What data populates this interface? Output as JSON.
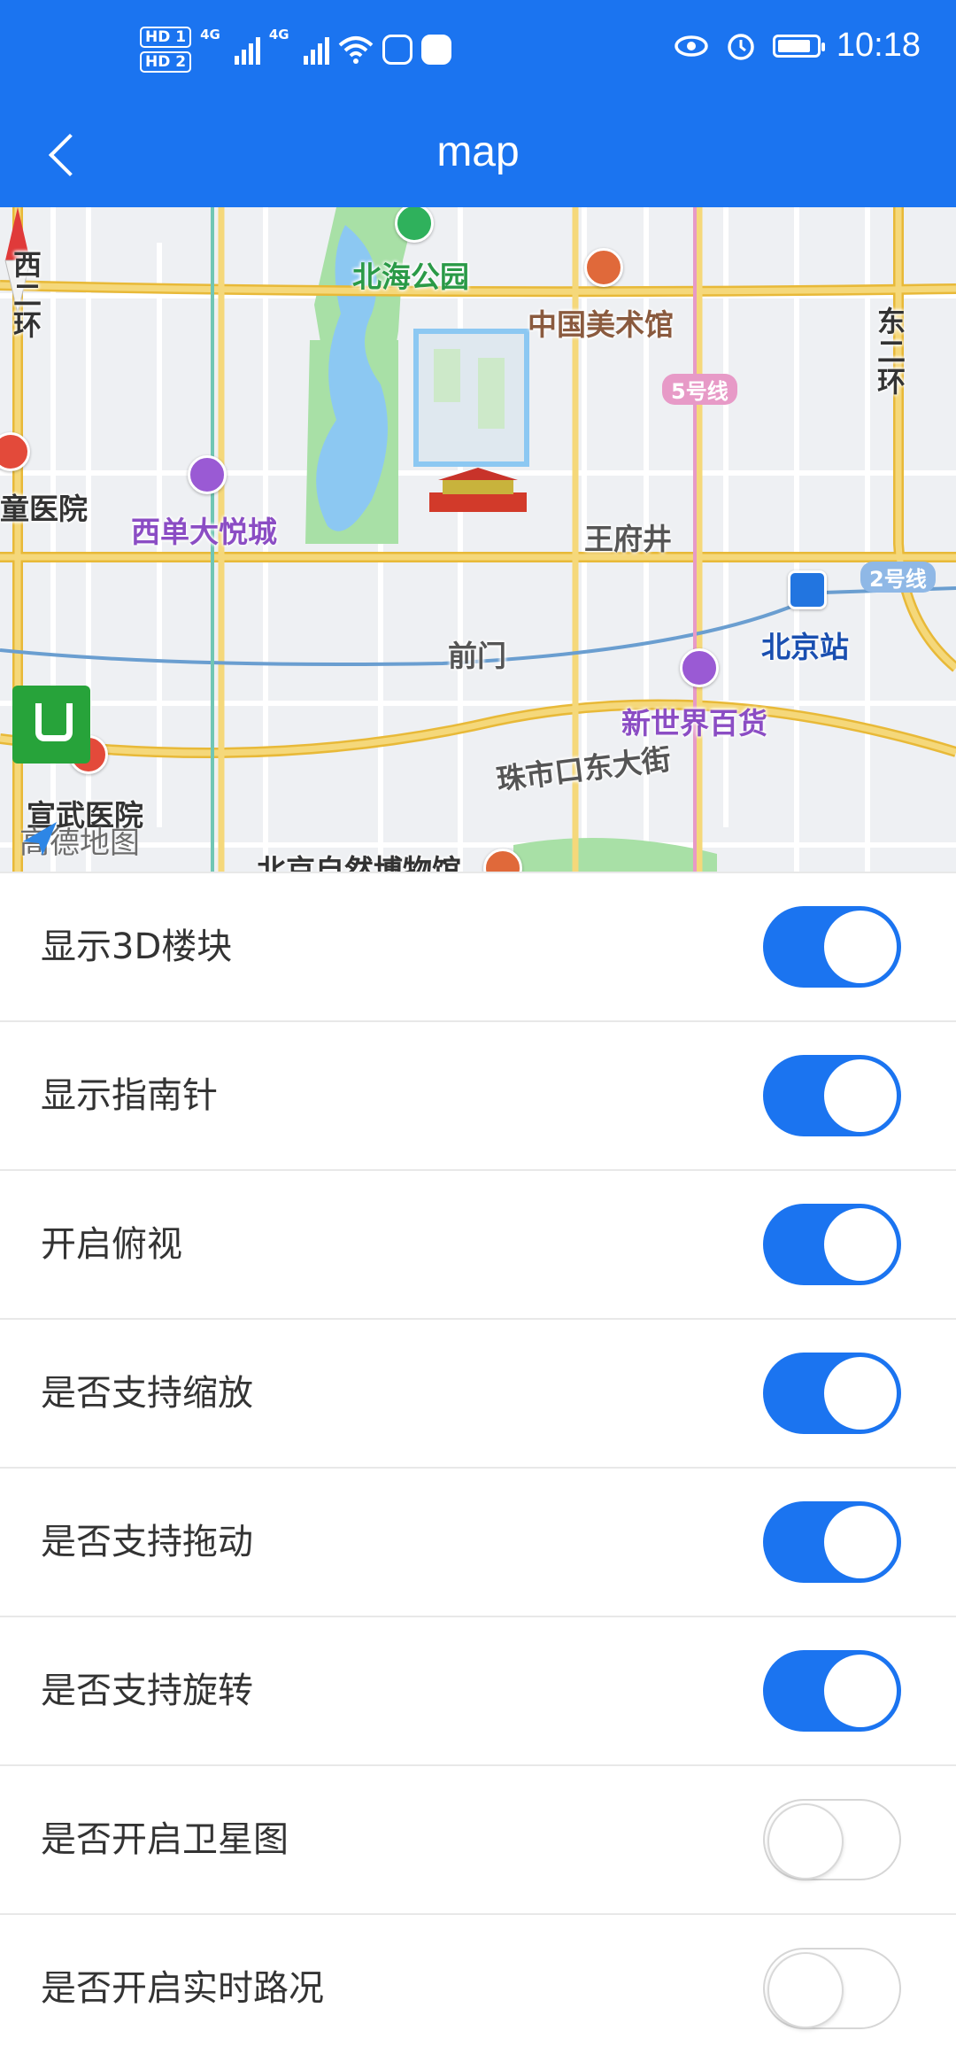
{
  "status_bar": {
    "hd1": "HD 1",
    "hd2": "HD 2",
    "sig1": "4G",
    "sig2": "4G",
    "time": "10:18"
  },
  "header": {
    "title": "map"
  },
  "map": {
    "labels": {
      "beihai_park": "北海公园",
      "art_museum": "中国美术馆",
      "line5": "5号线",
      "children_hospital": "童医院",
      "xidan_joy_city": "西单大悦城",
      "wangfujing": "王府井",
      "line2": "2号线",
      "qianmen": "前门",
      "beijing_station": "北京站",
      "new_world": "新世界百货",
      "zhushikou": "珠市口东大街",
      "xuanwu_hospital": "宣武医院",
      "west_2nd_ring": "西二环",
      "east_2nd_ring": "东二环",
      "natural_history": "北京自然博物馆"
    },
    "logo_text": "高德地图",
    "colors": {
      "road": "#f5d87a",
      "road_edge": "#e8b938",
      "water": "#8cc8f2",
      "park": "#a8e0a6",
      "subway": "#6a9ed0"
    }
  },
  "settings": [
    {
      "label": "显示3D楼块",
      "on": true
    },
    {
      "label": "显示指南针",
      "on": true
    },
    {
      "label": "开启俯视",
      "on": true
    },
    {
      "label": "是否支持缩放",
      "on": true
    },
    {
      "label": "是否支持拖动",
      "on": true
    },
    {
      "label": "是否支持旋转",
      "on": true
    },
    {
      "label": "是否开启卫星图",
      "on": false
    },
    {
      "label": "是否开启实时路况",
      "on": false
    }
  ],
  "colors": {
    "accent": "#1b74f0"
  }
}
